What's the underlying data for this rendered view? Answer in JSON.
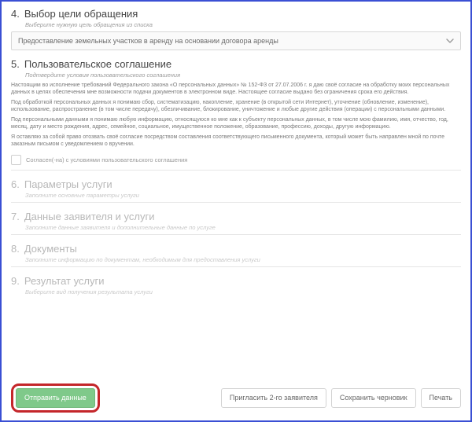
{
  "sections": {
    "s4": {
      "num": "4.",
      "title": "Выбор цели обращения",
      "sub": "Выберите нужную цель обращения из списка",
      "selectValue": "Предоставление земельных участков в аренду на основании договора аренды"
    },
    "s5": {
      "num": "5.",
      "title": "Пользовательское соглашение",
      "sub": "Подтвердите условия пользовательского соглашения",
      "p1": "Настоящим во исполнение требований Федерального закона «О персональных данных» № 152-ФЗ от 27.07.2006 г. я даю своё согласие на обработку моих персональных данных в целях обеспечения мне возможности подачи документов в электронном виде. Настоящее согласие выдано без ограничения срока его действия.",
      "p2": "Под обработкой персональных данных я понимаю сбор, систематизацию, накопление, хранение (в открытой сети Интернет), уточнение (обновление, изменение), использование, распространение (в том числе передачу), обезличивание, блокирование, уничтожение и любые другие действия (операции) с персональными данными.",
      "p3": "Под персональными данными я понимаю любую информацию, относящуюся ко мне как к субъекту персональных данных, в том числе мою фамилию, имя, отчество, год, месяц, дату и место рождения, адрес, семейное, социальное, имущественное положение, образование, профессию, доходы, другую информацию.",
      "p4": "Я оставляю за собой право отозвать своё согласие посредством составления соответствующего письменного документа, который может быть направлен мной по почте заказным письмом с уведомлением о вручении.",
      "consentLabel": "Согласен(-на) с условиями пользовательского соглашения"
    },
    "s6": {
      "num": "6.",
      "title": "Параметры услуги",
      "sub": "Заполните основные параметры услуги"
    },
    "s7": {
      "num": "7.",
      "title": "Данные заявителя и услуги",
      "sub": "Заполните данные заявителя и дополнительные данные по услуге"
    },
    "s8": {
      "num": "8.",
      "title": "Документы",
      "sub": "Заполните информацию по документам, необходимым для предоставления услуги"
    },
    "s9": {
      "num": "9.",
      "title": "Результат услуги",
      "sub": "Выберите вид получения результата услуги"
    }
  },
  "footer": {
    "submit": "Отправить данные",
    "invite": "Пригласить 2-го заявителя",
    "draft": "Сохранить черновик",
    "print": "Печать"
  }
}
